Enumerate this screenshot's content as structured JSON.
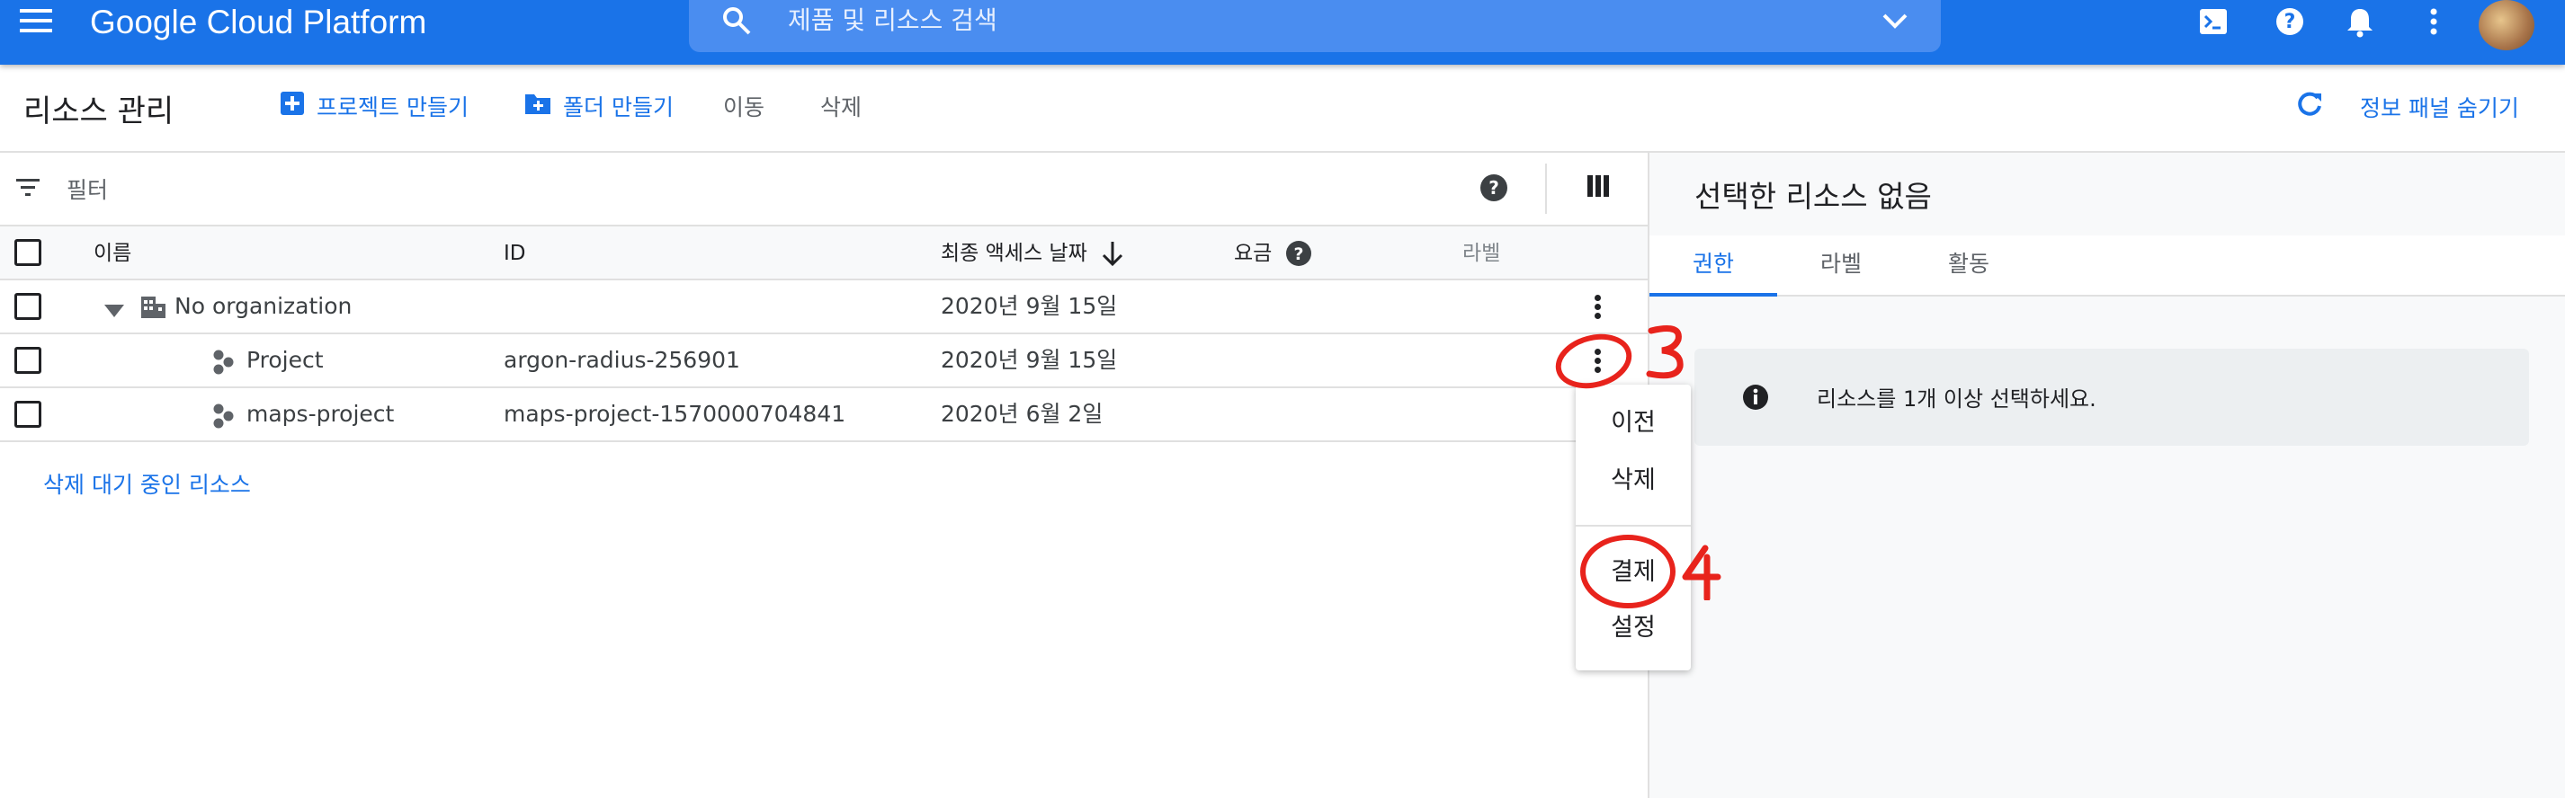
{
  "header": {
    "brand": "Google Cloud Platform",
    "search_placeholder": "제품 및 리소스 검색",
    "accent": "#1a73e8",
    "icons": [
      "menu-icon",
      "search-icon",
      "chevron-down-icon",
      "terminal-icon",
      "help-icon",
      "bell-icon",
      "more-vert-icon",
      "avatar"
    ]
  },
  "actionbar": {
    "title": "리소스 관리",
    "create_project": "프로젝트 만들기",
    "create_folder": "폴더 만들기",
    "move": "이동",
    "delete": "삭제",
    "hide_info_panel": "정보 패널 숨기기"
  },
  "filter": {
    "label": "필터"
  },
  "table": {
    "columns": {
      "name": "이름",
      "id": "ID",
      "last_access": "최종 액세스 날짜",
      "charges": "요금",
      "labels": "라벨"
    },
    "rows": [
      {
        "name": "No organization",
        "id": "",
        "last_access": "2020년 9월 15일"
      },
      {
        "name": "Project",
        "id": "argon-radius-256901",
        "last_access": "2020년 9월 15일"
      },
      {
        "name": "maps-project",
        "id": "maps-project-1570000704841",
        "last_access": "2020년 6월 2일"
      }
    ],
    "pending_deletion": "삭제 대기 중인 리소스"
  },
  "context_menu": {
    "items": [
      "이전",
      "삭제",
      "결제",
      "설정"
    ]
  },
  "info_panel": {
    "title": "선택한 리소스 없음",
    "tabs": [
      "권한",
      "라벨",
      "활동"
    ],
    "active_tab": "권한",
    "message": "리소스를 1개 이상 선택하세요."
  },
  "annotations": {
    "step3": "3",
    "step4": "4",
    "color": "#e8231c"
  }
}
